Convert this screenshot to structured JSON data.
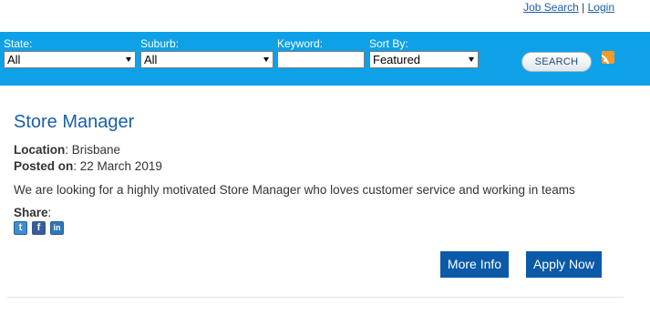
{
  "top_links": {
    "job_search": "Job Search",
    "separator": "|",
    "login": "Login"
  },
  "filters": {
    "state": {
      "label": "State:",
      "value": "All"
    },
    "suburb": {
      "label": "Suburb:",
      "value": "All"
    },
    "keyword": {
      "label": "Keyword:",
      "value": ""
    },
    "sort_by": {
      "label": "Sort By:",
      "value": "Featured"
    },
    "search_button": "SEARCH"
  },
  "job": {
    "title": "Store Manager",
    "location_label": "Location",
    "location": "Brisbane",
    "posted_label": "Posted on",
    "posted_date": "22 March 2019",
    "description": "We are looking for a highly motivated Store Manager who loves customer service and working in teams",
    "share_label": "Share",
    "share_icons": [
      "twitter-icon",
      "facebook-icon",
      "linkedin-icon"
    ],
    "more_info_button": "More Info",
    "apply_button": "Apply Now"
  },
  "colors": {
    "filter_bar": "#0ea1e8",
    "button": "#0a5aa8",
    "title": "#1a5fa8",
    "rss": "#f49a2a"
  }
}
